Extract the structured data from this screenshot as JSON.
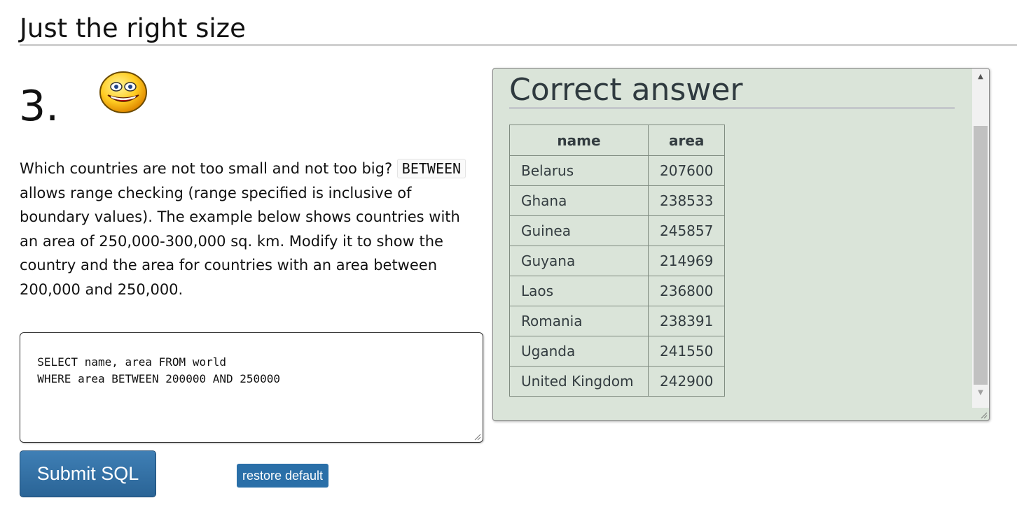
{
  "page": {
    "title": "Just the right size"
  },
  "question": {
    "number": "3.",
    "text_before": "Which countries are not too small and not too big? ",
    "code_keyword": "BETWEEN",
    "text_after": " allows range checking (range specified is inclusive of boundary values). The example below shows countries with an area of 250,000-300,000 sq. km. Modify it to show the country and the area for countries with an area between 200,000 and 250,000."
  },
  "editor": {
    "sql": "SELECT name, area FROM world\n  WHERE area BETWEEN 200000 AND 250000"
  },
  "buttons": {
    "submit_label": "Submit SQL",
    "restore_label": "restore default"
  },
  "answer": {
    "heading": "Correct answer",
    "columns": [
      "name",
      "area"
    ],
    "rows": [
      {
        "name": "Belarus",
        "area": "207600"
      },
      {
        "name": "Ghana",
        "area": "238533"
      },
      {
        "name": "Guinea",
        "area": "245857"
      },
      {
        "name": "Guyana",
        "area": "214969"
      },
      {
        "name": "Laos",
        "area": "236800"
      },
      {
        "name": "Romania",
        "area": "238391"
      },
      {
        "name": "Uganda",
        "area": "241550"
      },
      {
        "name": "United Kingdom",
        "area": "242900"
      }
    ]
  },
  "icons": {
    "smiley": "grinning-face-icon",
    "scroll_up": "scroll-up-arrow-icon",
    "scroll_down": "scroll-down-arrow-icon",
    "resize": "resize-grip-icon"
  },
  "colors": {
    "answer_background": "#dae4d9",
    "button_blue": "#2a6496"
  }
}
